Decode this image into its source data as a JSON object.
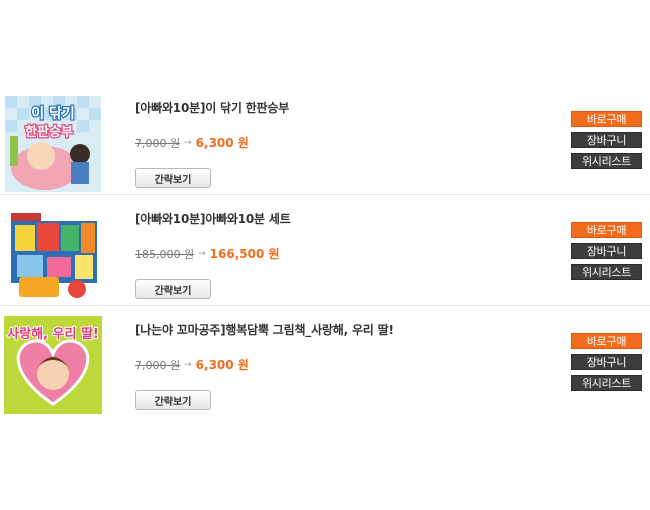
{
  "products": [
    {
      "title": "[아빠와10분]이 닦기 한판승부",
      "original_price": "7,000 원",
      "sale_price": "6,300 원",
      "quick_view_label": "간략보기",
      "buy_label": "바로구매",
      "cart_label": "장바구니",
      "wishlist_label": "위시리스트",
      "cover_text": [
        "이 닦기",
        "한판승부"
      ]
    },
    {
      "title": "[아빠와10분]아빠와10분 세트",
      "original_price": "185,000 원",
      "sale_price": "166,500 원",
      "quick_view_label": "간략보기",
      "buy_label": "바로구매",
      "cart_label": "장바구니",
      "wishlist_label": "위시리스트"
    },
    {
      "title": "[나는야 꼬마공주]행복담뿍 그림책_사랑해, 우리 딸!",
      "original_price": "7,000 원",
      "sale_price": "6,300 원",
      "quick_view_label": "간략보기",
      "buy_label": "바로구매",
      "cart_label": "장바구니",
      "wishlist_label": "위시리스트",
      "cover_text": [
        "사랑해, 우리 딸!"
      ]
    }
  ],
  "colors": {
    "accent": "#f26c1d",
    "dark_button": "#3d3d3d"
  }
}
